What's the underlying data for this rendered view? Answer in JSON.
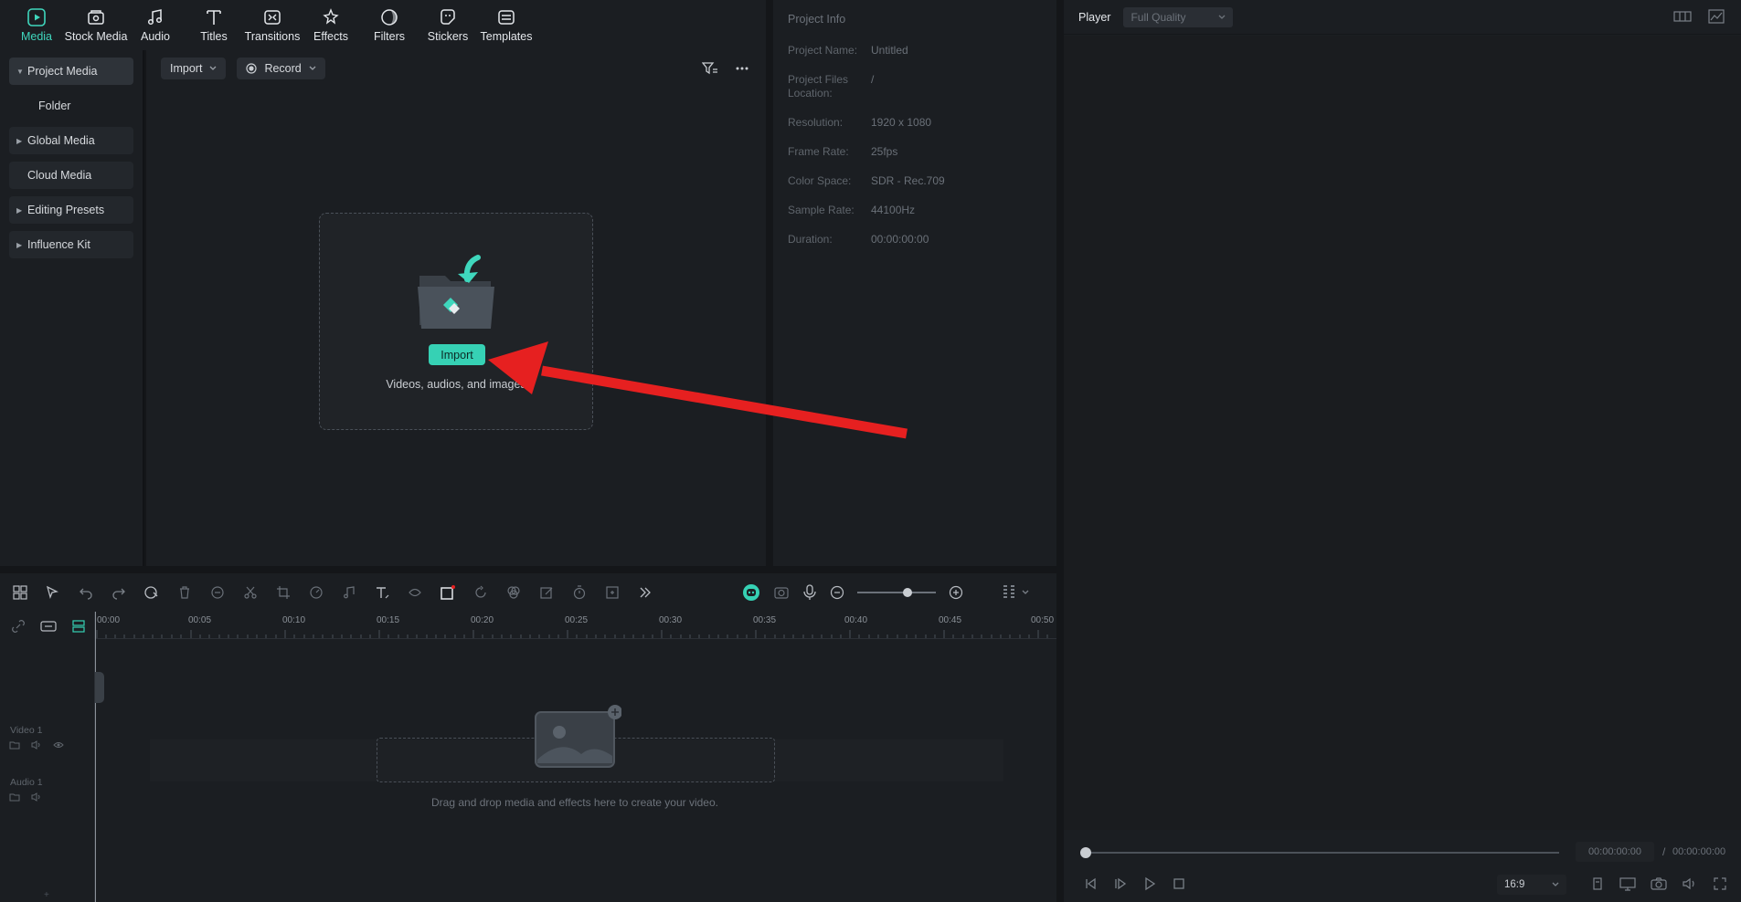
{
  "top_tabs": [
    {
      "label": "Media",
      "icon": "media-icon"
    },
    {
      "label": "Stock Media",
      "icon": "stock-media-icon"
    },
    {
      "label": "Audio",
      "icon": "audio-icon"
    },
    {
      "label": "Titles",
      "icon": "titles-icon"
    },
    {
      "label": "Transitions",
      "icon": "transitions-icon"
    },
    {
      "label": "Effects",
      "icon": "effects-icon"
    },
    {
      "label": "Filters",
      "icon": "filters-icon"
    },
    {
      "label": "Stickers",
      "icon": "stickers-icon"
    },
    {
      "label": "Templates",
      "icon": "templates-icon"
    }
  ],
  "sidebar": {
    "items": [
      {
        "label": "Project Media"
      },
      {
        "label": "Folder"
      },
      {
        "label": "Global Media"
      },
      {
        "label": "Cloud Media"
      },
      {
        "label": "Editing Presets"
      },
      {
        "label": "Influence Kit"
      }
    ]
  },
  "media": {
    "import_dropdown": "Import",
    "record_dropdown": "Record",
    "import_button": "Import",
    "caption": "Videos, audios, and images"
  },
  "project_info": {
    "title": "Project Info",
    "rows": [
      {
        "key": "Project Name:",
        "value": "Untitled"
      },
      {
        "key": "Project Files Location:",
        "value": "/"
      },
      {
        "key": "Resolution:",
        "value": "1920 x 1080"
      },
      {
        "key": "Frame Rate:",
        "value": "25fps"
      },
      {
        "key": "Color Space:",
        "value": "SDR - Rec.709"
      },
      {
        "key": "Sample Rate:",
        "value": "44100Hz"
      },
      {
        "key": "Duration:",
        "value": "00:00:00:00"
      }
    ]
  },
  "player": {
    "title": "Player",
    "quality": "Full Quality",
    "current_time": "00:00:00:00",
    "separator": "/",
    "total_time": "00:00:00:00",
    "ratio": "16:9"
  },
  "timeline": {
    "ruler": [
      "00:00",
      "00:05",
      "00:10",
      "00:15",
      "00:20",
      "00:25",
      "00:30",
      "00:35",
      "00:40",
      "00:45",
      "00:50"
    ],
    "tracks": [
      {
        "label": "Video 1"
      },
      {
        "label": "Audio 1"
      }
    ],
    "drop_caption": "Drag and drop media and effects here to create your video."
  },
  "colors": {
    "accent": "#36d1b4",
    "arrow": "#e62020"
  }
}
